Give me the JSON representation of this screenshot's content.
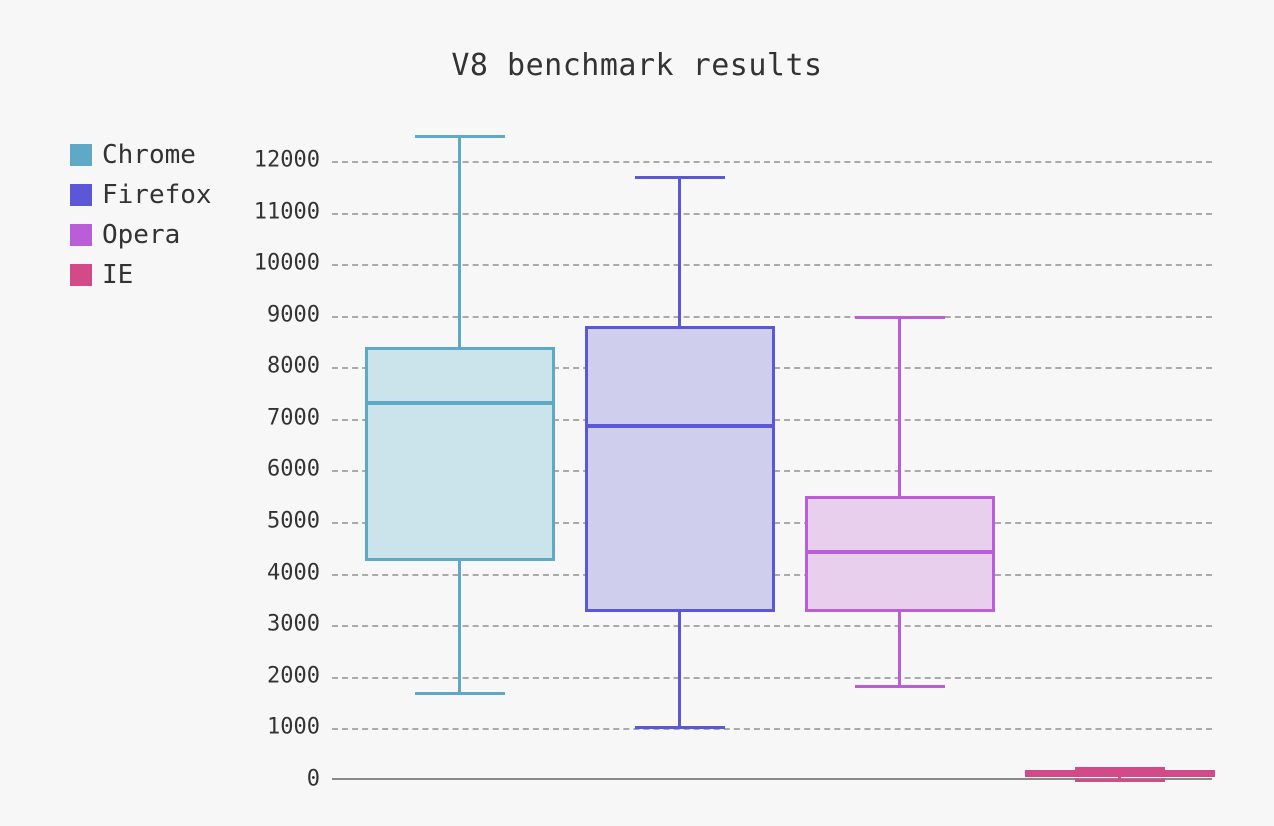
{
  "chart_data": {
    "type": "boxplot",
    "title": "V8 benchmark results",
    "xlabel": "",
    "ylabel": "",
    "ylim": [
      0,
      12600
    ],
    "y_ticks": [
      0,
      1000,
      2000,
      3000,
      4000,
      5000,
      6000,
      7000,
      8000,
      9000,
      10000,
      11000,
      12000
    ],
    "categories": [
      "Chrome",
      "Firefox",
      "Opera",
      "IE"
    ],
    "series": [
      {
        "name": "Chrome",
        "color": "#5FA9C6",
        "fill": "#CBE3EB",
        "min": 1700,
        "q1": 4250,
        "median": 7350,
        "q3": 8400,
        "max": 12500
      },
      {
        "name": "Firefox",
        "color": "#5B57D6",
        "fill": "#CFCEED",
        "min": 1050,
        "q1": 3250,
        "median": 6900,
        "q3": 8800,
        "max": 11700
      },
      {
        "name": "Opera",
        "color": "#B95ED6",
        "fill": "#E9CFEE",
        "min": 1850,
        "q1": 3250,
        "median": 4450,
        "q3": 5500,
        "max": 9000
      },
      {
        "name": "IE",
        "color": "#D24A87",
        "fill": "#EDC9DB",
        "min": 20,
        "q1": 80,
        "median": 130,
        "q3": 190,
        "max": 250
      }
    ],
    "legend": {
      "position": "upper-left-outside",
      "items": [
        "Chrome",
        "Firefox",
        "Opera",
        "IE"
      ]
    }
  }
}
